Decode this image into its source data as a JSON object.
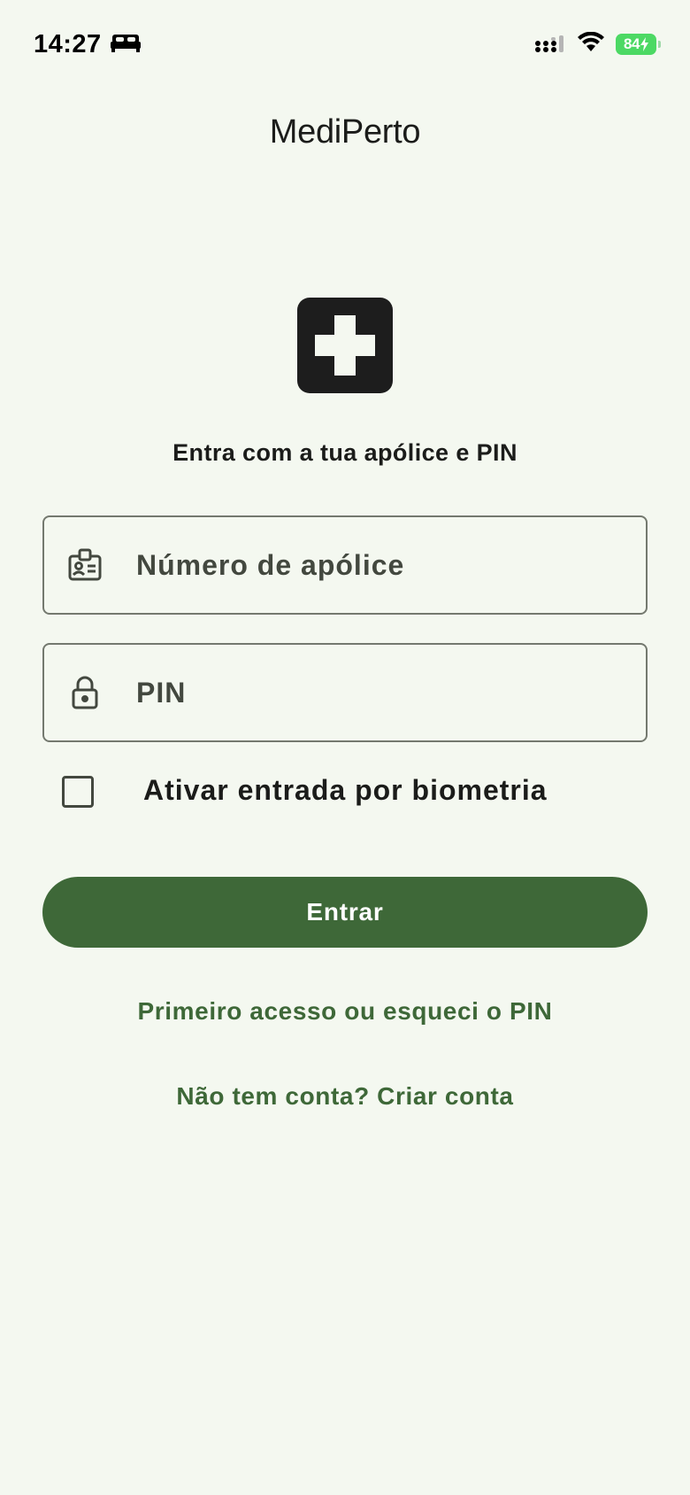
{
  "status_bar": {
    "time": "14:27",
    "battery": "84",
    "icons": [
      "bed-icon",
      "signal-icon",
      "wifi-icon",
      "battery-icon",
      "charging-bolt-icon"
    ]
  },
  "app": {
    "title": "MediPerto",
    "logo_icon": "medical-cross-icon"
  },
  "login": {
    "subtitle": "Entra com a tua apólice e PIN",
    "policy_field": {
      "placeholder": "Número de apólice",
      "value": "",
      "icon": "id-badge-icon"
    },
    "pin_field": {
      "placeholder": "PIN",
      "value": "",
      "icon": "lock-icon"
    },
    "biometric": {
      "label": "Ativar entrada por biometria",
      "checked": false
    },
    "submit_label": "Entrar",
    "forgot_link": "Primeiro acesso ou esqueci o PIN",
    "create_link": "Não tem conta? Criar conta"
  },
  "colors": {
    "background": "#f4f8f0",
    "primary": "#3e6838",
    "outline": "#74796f",
    "on_surface": "#1b1c1a",
    "battery": "#4cd964"
  }
}
